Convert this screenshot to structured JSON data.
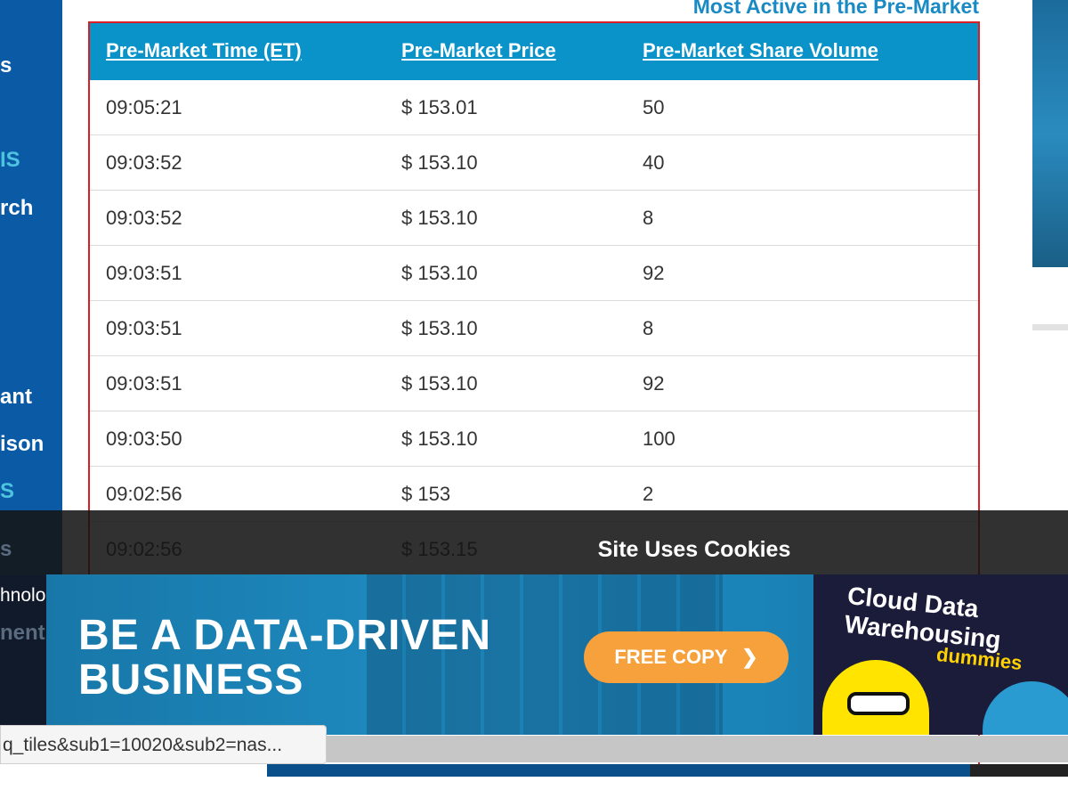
{
  "leftnav": {
    "items": [
      {
        "label": "s",
        "accent": false
      },
      {
        "label": "IS",
        "accent": true
      },
      {
        "label": "rch",
        "accent": false
      },
      {
        "label": "ant",
        "accent": false
      },
      {
        "label": "ison",
        "accent": false
      },
      {
        "label": "S",
        "accent": true
      },
      {
        "label": "s",
        "accent": false
      },
      {
        "label": "hnolo",
        "accent": false
      },
      {
        "label": "nent",
        "accent": false
      }
    ]
  },
  "section": {
    "title": "Most Active in the Pre-Market"
  },
  "table": {
    "headers": [
      "Pre-Market Time (ET)",
      "Pre-Market Price",
      "Pre-Market Share Volume"
    ],
    "rows": [
      [
        "09:05:21",
        "$ 153.01",
        "50"
      ],
      [
        "09:03:52",
        "$ 153.10",
        "40"
      ],
      [
        "09:03:52",
        "$ 153.10",
        "8"
      ],
      [
        "09:03:51",
        "$ 153.10",
        "92"
      ],
      [
        "09:03:51",
        "$ 153.10",
        "8"
      ],
      [
        "09:03:51",
        "$ 153.10",
        "92"
      ],
      [
        "09:03:50",
        "$ 153.10",
        "100"
      ],
      [
        "09:02:56",
        "$ 153",
        "2"
      ],
      [
        "09:02:56",
        "$ 153.15",
        ""
      ]
    ]
  },
  "cookie": {
    "title": "Site Uses Cookies"
  },
  "ad": {
    "headline_line1": "BE A DATA-DRIVEN",
    "headline_line2": "BUSINESS",
    "cta": "FREE COPY",
    "cta_icon": "chevron-right-icon",
    "book_title_line1": "Cloud Data",
    "book_title_line2": "Warehousing",
    "book_brand": "dummies"
  },
  "status": {
    "url": "q_tiles&sub1=10020&sub2=nas..."
  },
  "colors": {
    "nav_bg": "#0a5aa6",
    "header_bg": "#0a93c9",
    "title": "#1a8ac4",
    "highlight_border": "#d81f26",
    "cta": "#f7a13d"
  }
}
